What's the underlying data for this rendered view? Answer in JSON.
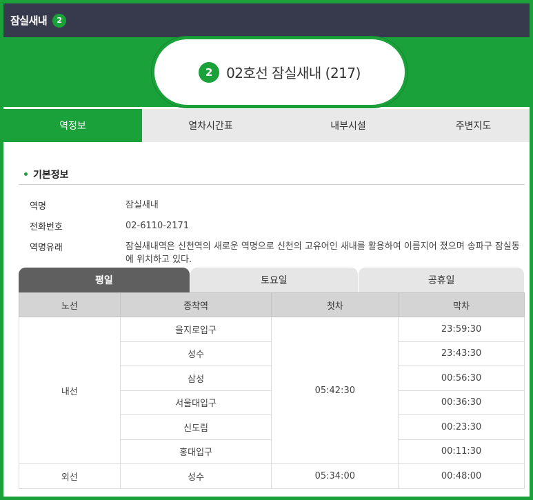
{
  "header": {
    "title": "잠실새내",
    "line_number": "2"
  },
  "station_banner": {
    "line_number": "2",
    "title": "02호선 잠실새내 (217)"
  },
  "main_tabs": [
    {
      "label": "역정보",
      "active": true
    },
    {
      "label": "열차시간표",
      "active": false
    },
    {
      "label": "내부시설",
      "active": false
    },
    {
      "label": "주변지도",
      "active": false
    }
  ],
  "basic_info": {
    "section_title": "기본정보",
    "rows": [
      {
        "label": "역명",
        "value": "잠실새내"
      },
      {
        "label": "전화번호",
        "value": "02-6110-2171"
      },
      {
        "label": "역명유래",
        "value": "잠실새내역은 신천역의 새로운 역명으로 신천의 고유어인 새내를 활용하여 이름지어 졌으며 송파구 잠실동에 위치하고 있다."
      }
    ]
  },
  "schedule_tabs": [
    {
      "label": "평일",
      "active": true
    },
    {
      "label": "토요일",
      "active": false
    },
    {
      "label": "공휴일",
      "active": false
    }
  ],
  "schedule_table": {
    "headers": [
      "노선",
      "종착역",
      "첫차",
      "막차"
    ],
    "groups": [
      {
        "line": "내선",
        "rows": [
          {
            "terminal": "을지로입구",
            "first": "",
            "last": "23:59:30"
          },
          {
            "terminal": "성수",
            "first": "05:42:30",
            "last": "23:43:30"
          },
          {
            "terminal": "삼성",
            "first": "",
            "last": "00:56:30"
          },
          {
            "terminal": "서울대입구",
            "first": "",
            "last": "00:36:30"
          },
          {
            "terminal": "신도림",
            "first": "",
            "last": "00:23:30"
          },
          {
            "terminal": "홍대입구",
            "first": "",
            "last": "00:11:30"
          }
        ]
      },
      {
        "line": "외선",
        "rows": [
          {
            "terminal": "성수",
            "first": "05:34:00",
            "last": "00:48:00"
          }
        ]
      }
    ]
  },
  "colors": {
    "accent": "#1aa13a",
    "header_bg": "#363a4c",
    "tab_inactive": "#e9e9e9",
    "schedule_tab_active": "#5f5f5f"
  }
}
